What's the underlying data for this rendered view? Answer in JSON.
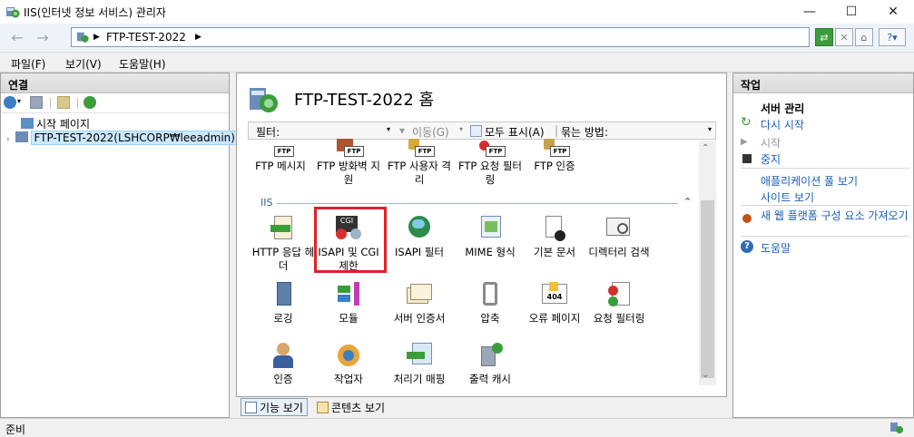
{
  "window": {
    "title": "IIS(인터넷 정보 서비스) 관리자"
  },
  "address": {
    "crumbs": [
      "FTP-TEST-2022"
    ]
  },
  "menu": [
    "파일(F)",
    "보기(V)",
    "도움말(H)"
  ],
  "connections": {
    "title": "연결",
    "tree": [
      {
        "label": "시작 페이지"
      },
      {
        "label": "FTP-TEST-2022(LSHCORP₩leeadmin)"
      }
    ]
  },
  "center": {
    "title": "FTP-TEST-2022 홈",
    "filter_label": "필터:",
    "go_label": "이동(G)",
    "show_all_label": "모두 표시(A)",
    "group_label": "묶는 방법:",
    "ftp_features": [
      {
        "label": "FTP 메시지"
      },
      {
        "label": "FTP 방화벽 지원"
      },
      {
        "label": "FTP 사용자 격리"
      },
      {
        "label": "FTP 요청 필터링"
      },
      {
        "label": "FTP 인증"
      }
    ],
    "iis_group_label": "IIS",
    "iis_features": [
      {
        "label": "HTTP 응답 헤더"
      },
      {
        "label": "ISAPI 및 CGI 제한"
      },
      {
        "label": "ISAPI 필터"
      },
      {
        "label": "MIME 형식"
      },
      {
        "label": "기본 문서"
      },
      {
        "label": "디렉터리 검색"
      },
      {
        "label": "로깅"
      },
      {
        "label": "모듈"
      },
      {
        "label": "서버 인증서"
      },
      {
        "label": "압축"
      },
      {
        "label": "오류 페이지"
      },
      {
        "label": "요청 필터링"
      },
      {
        "label": "인증"
      },
      {
        "label": "작업자"
      },
      {
        "label": "처리기 매핑"
      },
      {
        "label": "출력 캐시"
      }
    ],
    "tabs": {
      "features": "기능 보기",
      "content": "콘텐츠 보기"
    }
  },
  "actions": {
    "title": "작업",
    "server_group": "서버 관리",
    "restart": "다시 시작",
    "start": "시작",
    "stop": "중지",
    "view_app_pools": "애플리케이션 풀 보기",
    "view_sites": "사이트 보기",
    "get_new_platform": "새 웹 플랫폼 구성 요소 가져오기",
    "help": "도움말"
  },
  "status": {
    "text": "준비"
  },
  "colors": {
    "highlight_box": "#e0202a",
    "link": "#1a5fb4",
    "selection": "#cce8ff"
  }
}
